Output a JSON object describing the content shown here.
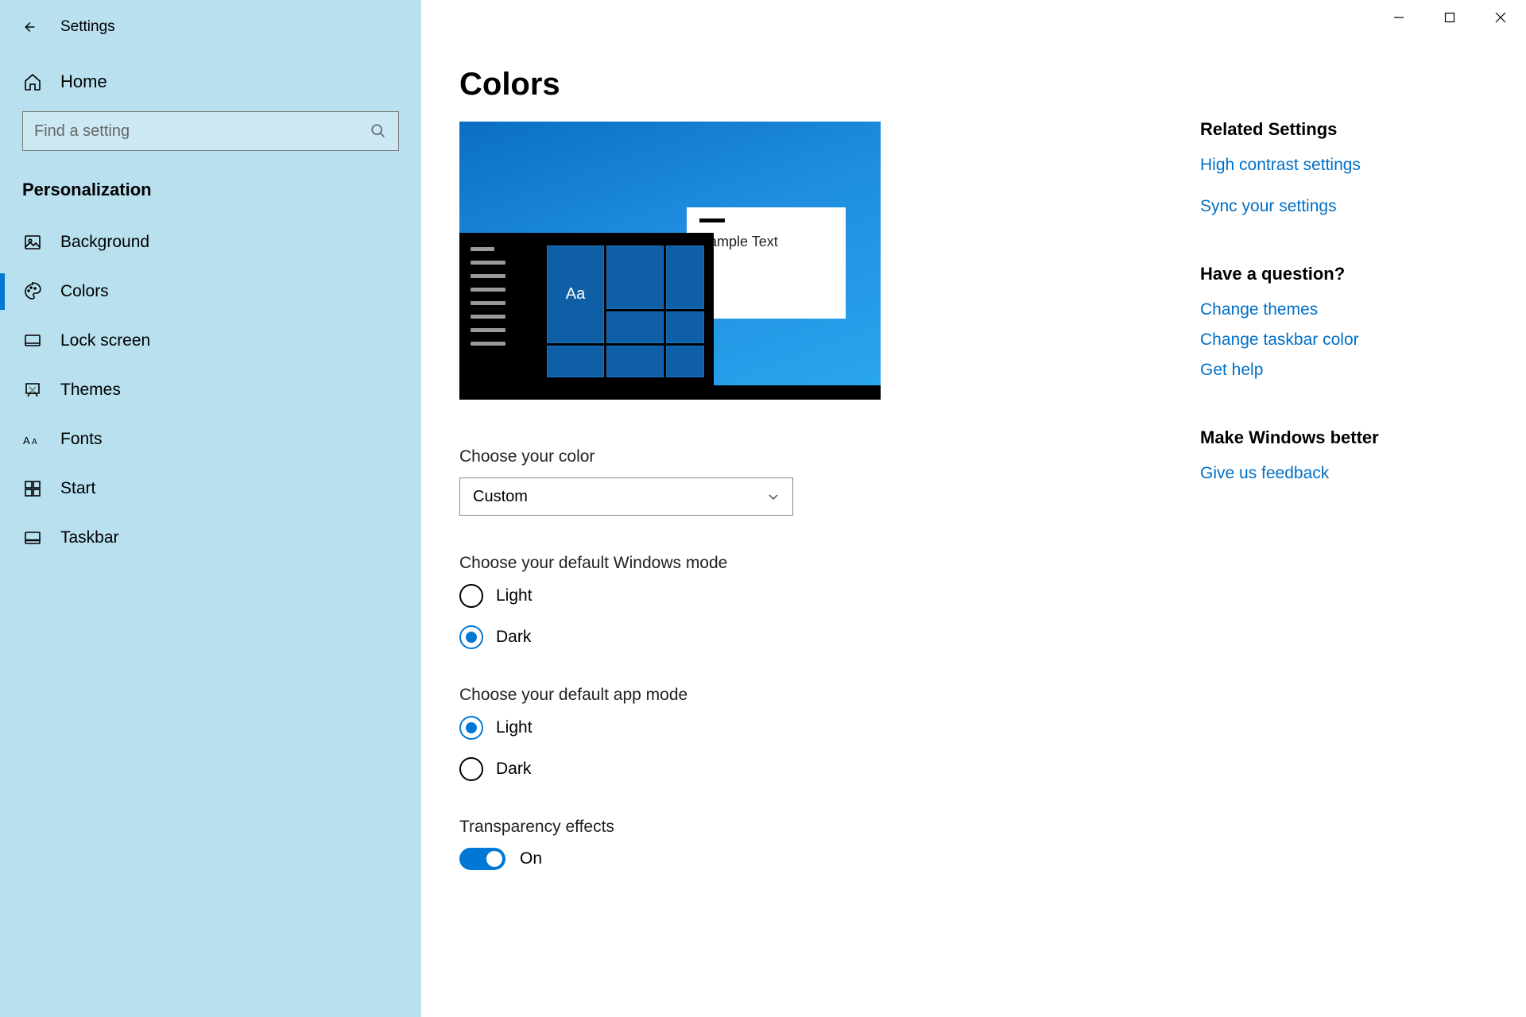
{
  "window": {
    "title": "Settings"
  },
  "sidebar": {
    "home_label": "Home",
    "search_placeholder": "Find a setting",
    "category_label": "Personalization",
    "items": [
      {
        "label": "Background",
        "icon": "image-icon",
        "active": false
      },
      {
        "label": "Colors",
        "icon": "palette-icon",
        "active": true
      },
      {
        "label": "Lock screen",
        "icon": "lock-screen-icon",
        "active": false
      },
      {
        "label": "Themes",
        "icon": "themes-icon",
        "active": false
      },
      {
        "label": "Fonts",
        "icon": "fonts-icon",
        "active": false
      },
      {
        "label": "Start",
        "icon": "start-icon",
        "active": false
      },
      {
        "label": "Taskbar",
        "icon": "taskbar-icon",
        "active": false
      }
    ]
  },
  "main": {
    "page_title": "Colors",
    "preview_sample_text": "Sample Text",
    "preview_tile_text": "Aa",
    "choose_color_label": "Choose your color",
    "choose_color_value": "Custom",
    "windows_mode_label": "Choose your default Windows mode",
    "windows_mode_options": [
      "Light",
      "Dark"
    ],
    "windows_mode_selected": "Dark",
    "app_mode_label": "Choose your default app mode",
    "app_mode_options": [
      "Light",
      "Dark"
    ],
    "app_mode_selected": "Light",
    "transparency_label": "Transparency effects",
    "transparency_value": "On"
  },
  "right": {
    "related_heading": "Related Settings",
    "related_links": [
      "High contrast settings",
      "Sync your settings"
    ],
    "question_heading": "Have a question?",
    "question_links": [
      "Change themes",
      "Change taskbar color",
      "Get help"
    ],
    "feedback_heading": "Make Windows better",
    "feedback_links": [
      "Give us feedback"
    ]
  },
  "colors": {
    "accent": "#0078d4",
    "link": "#006fc6",
    "sidebar_bg": "#b8e0ee"
  }
}
